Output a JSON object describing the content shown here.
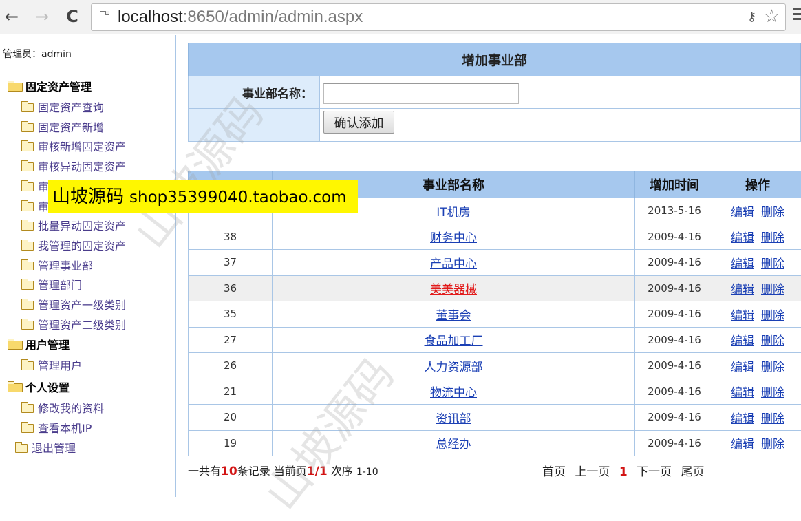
{
  "browser": {
    "url_host": "localhost",
    "url_rest": ":8650/admin/admin.aspx",
    "back_glyph": "←",
    "forward_glyph": "→",
    "reload_glyph": "C",
    "key_glyph": "⚷",
    "star_glyph": "☆"
  },
  "sidebar": {
    "admin_label": "管理员：admin",
    "groups": [
      {
        "title": "固定资产管理",
        "items": [
          "固定资产查询",
          "固定资产新增",
          "审核新增固定资产",
          "审核异动固定资产",
          "审",
          "审",
          "批量异动固定资产",
          "我管理的固定资产",
          "管理事业部",
          "管理部门",
          "管理资产一级类别",
          "管理资产二级类别"
        ]
      },
      {
        "title": "用户管理",
        "items": [
          "管理用户"
        ]
      },
      {
        "title": "个人设置",
        "items": [
          "修改我的资料",
          "查看本机IP"
        ]
      }
    ],
    "logout": "退出管理"
  },
  "form": {
    "title": "增加事业部",
    "field_label": "事业部名称：",
    "field_value": "",
    "submit_label": "确认添加"
  },
  "list": {
    "headers": [
      "",
      "事业部名称",
      "增加时间",
      "操作"
    ],
    "edit_label": "编辑",
    "delete_label": "删除",
    "rows": [
      {
        "id": "",
        "name": "IT机房",
        "date": "2013-5-16"
      },
      {
        "id": "38",
        "name": "财务中心",
        "date": "2009-4-16"
      },
      {
        "id": "37",
        "name": "产品中心",
        "date": "2009-4-16"
      },
      {
        "id": "36",
        "name": "美美器械",
        "date": "2009-4-16"
      },
      {
        "id": "35",
        "name": "董事会",
        "date": "2009-4-16"
      },
      {
        "id": "27",
        "name": "食品加工厂",
        "date": "2009-4-16"
      },
      {
        "id": "26",
        "name": "人力资源部",
        "date": "2009-4-16"
      },
      {
        "id": "21",
        "name": "物流中心",
        "date": "2009-4-16"
      },
      {
        "id": "20",
        "name": "资讯部",
        "date": "2009-4-16"
      },
      {
        "id": "19",
        "name": "总经办",
        "date": "2009-4-16"
      }
    ],
    "highlight_row": 3
  },
  "pager": {
    "total_prefix": "一共有",
    "total": "10",
    "total_suffix": "条记录 当前页",
    "page_state": "1/1",
    "range_label": " 次序 ",
    "range": "1-10",
    "first": "首页",
    "prev": "上一页",
    "current": "1",
    "next": "下一页",
    "last": "尾页"
  },
  "watermark": {
    "text": "山坡源码",
    "banner_title": "山坡源码",
    "banner_shop": "shop35399040.taobao.com"
  },
  "colors": {
    "header_blue": "#a6c8ee",
    "label_blue": "#ddecfb",
    "link": "#1a3fb4",
    "accent_red": "#d21414",
    "banner_yellow": "#fff700"
  }
}
